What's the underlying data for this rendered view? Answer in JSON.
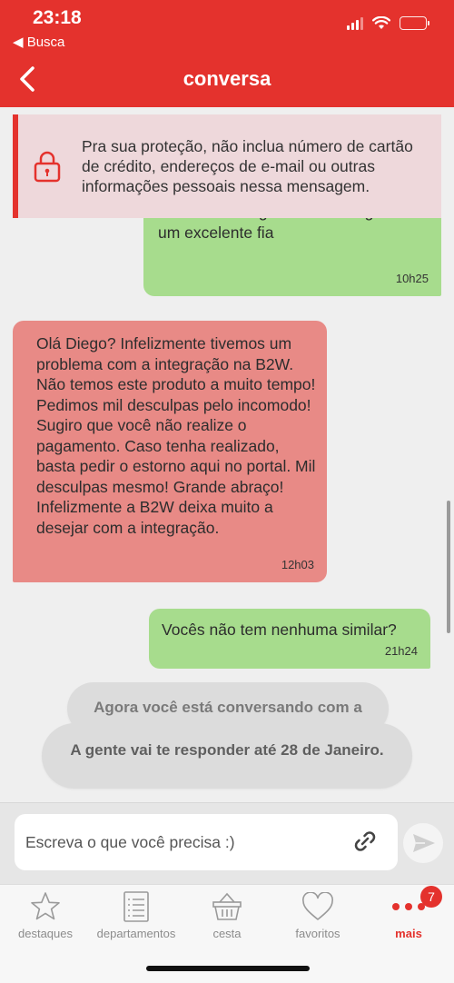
{
  "status_bar": {
    "time": "23:18",
    "back_app": "◀ Busca"
  },
  "header": {
    "title": "conversa"
  },
  "warning": {
    "text": "Pra sua proteção, não inclua número de cartão de crédito, endereços de e-mail ou outras informações pessoais nessa mensagem."
  },
  "messages": [
    {
      "direction": "out",
      "text": "transmitiram agora. Fico no aguardo um excelente fia",
      "time": "10h25"
    },
    {
      "direction": "in",
      "text": "Olá Diego? Infelizmente tivemos um problema com a integração na B2W. Não temos este produto a muito tempo! Pedimos mil desculpas pelo incomodo! Sugiro que você não realize o pagamento. Caso tenha realizado, basta pedir o estorno aqui no portal. Mil desculpas mesmo! Grande abraço! Infelizmente a B2W deixa muito a desejar com a integração.",
      "time": "12h03"
    },
    {
      "direction": "out",
      "text": "Vocês não tem nenhuma similar?",
      "time": "21h24"
    }
  ],
  "system_messages": [
    "Agora você está conversando com a",
    "A gente vai te responder até 28 de Janeiro."
  ],
  "input": {
    "placeholder": "Escreva o que você precisa :)"
  },
  "tabs": [
    {
      "label": "destaques",
      "icon": "star-icon"
    },
    {
      "label": "departamentos",
      "icon": "list-icon"
    },
    {
      "label": "cesta",
      "icon": "basket-icon"
    },
    {
      "label": "favoritos",
      "icon": "heart-icon"
    },
    {
      "label": "mais",
      "icon": "more-dots-icon",
      "active": true,
      "badge": "7"
    }
  ],
  "colors": {
    "brand": "#e4322d",
    "outgoing": "#a7dc8d",
    "incoming": "#e88a86",
    "warning_bg": "#eed8db"
  }
}
